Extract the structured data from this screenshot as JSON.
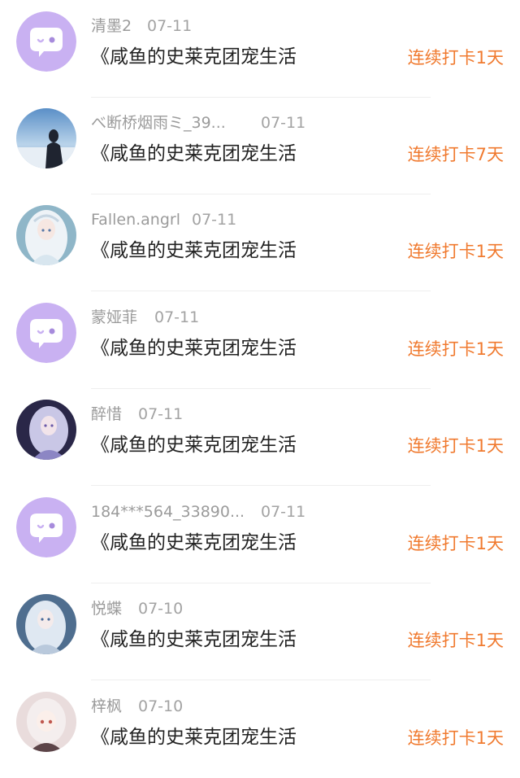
{
  "book_title": "《咸鱼的史莱克团宠生活",
  "accent_color": "#f07a2f",
  "avatar_placeholder_color": "#c9b1f2",
  "entries": [
    {
      "username": "清墨2",
      "date": "07-11",
      "checkin": "连续打卡1天",
      "avatar": "default-chat-icon"
    },
    {
      "username": "べ断桥烟雨ミ_39...",
      "date": "07-11",
      "checkin": "连续打卡7天",
      "avatar": "photo-silhouette-sky"
    },
    {
      "username": "Fallen.angrl",
      "date": "07-11",
      "checkin": "连续打卡1天",
      "avatar": "anime-girl-white-hair"
    },
    {
      "username": "蒙娅菲",
      "date": "07-11",
      "checkin": "连续打卡1天",
      "avatar": "default-chat-icon"
    },
    {
      "username": "醉惜",
      "date": "07-11",
      "checkin": "连续打卡1天",
      "avatar": "anime-girl-purple"
    },
    {
      "username": "184***564_33890...",
      "date": "07-11",
      "checkin": "连续打卡1天",
      "avatar": "default-chat-icon"
    },
    {
      "username": "悦蝶",
      "date": "07-10",
      "checkin": "连续打卡1天",
      "avatar": "anime-girl-blue-white"
    },
    {
      "username": "梓枫",
      "date": "07-10",
      "checkin": "连续打卡1天",
      "avatar": "anime-girl-pink"
    }
  ]
}
